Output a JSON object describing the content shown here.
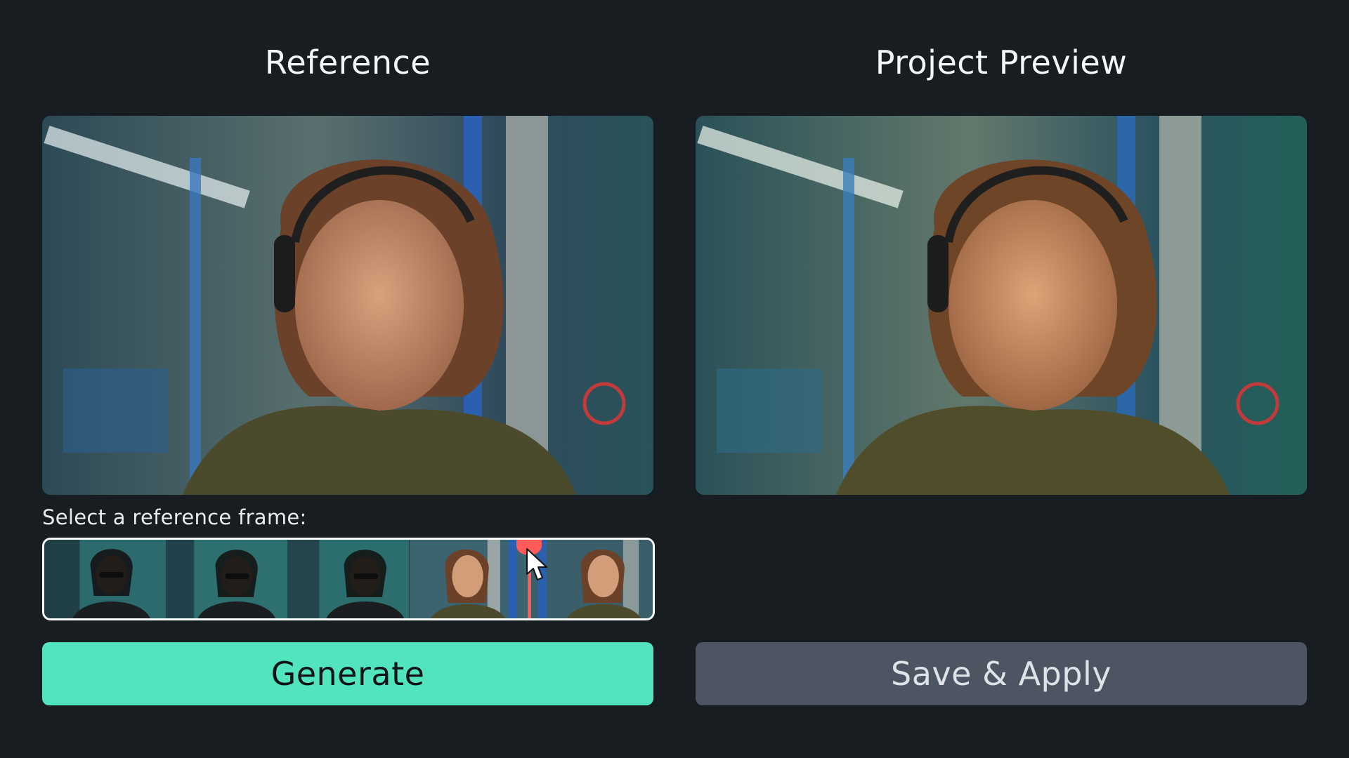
{
  "reference_panel": {
    "title": "Reference",
    "frame_prompt": "Select a reference frame:",
    "filmstrip": {
      "frame_count": 5,
      "selected_position": 0.8
    }
  },
  "preview_panel": {
    "title": "Project Preview"
  },
  "actions": {
    "generate_label": "Generate",
    "save_apply_label": "Save & Apply"
  },
  "colors": {
    "background": "#181d22",
    "generate_button": "#52e3bf",
    "save_button": "#4d5563",
    "playhead": "#ff5b5b"
  }
}
